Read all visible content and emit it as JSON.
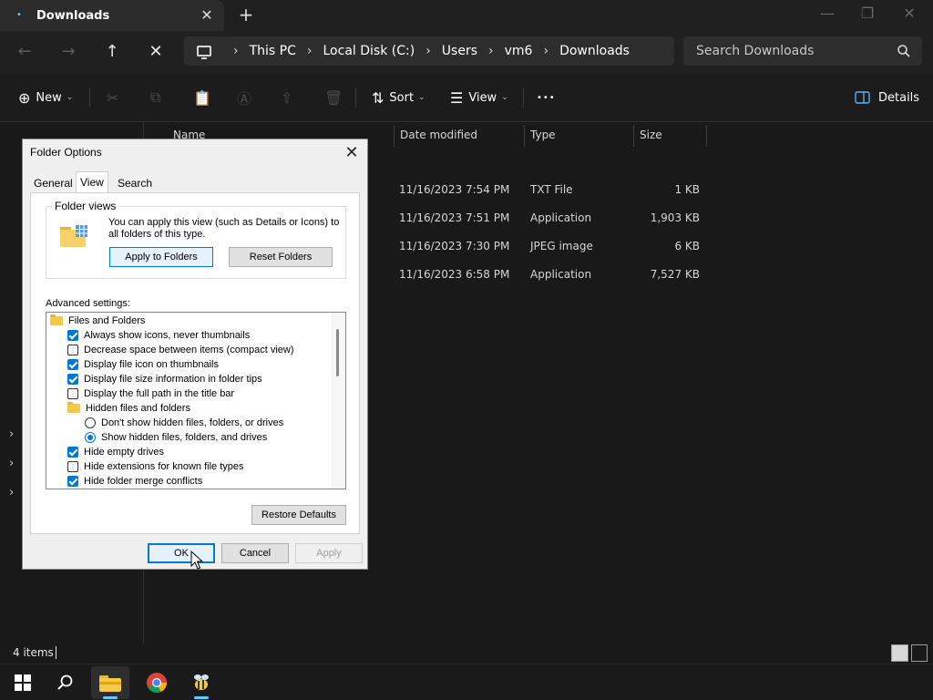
{
  "window": {
    "tab_title": "Downloads",
    "tab_close_glyph": "✕",
    "new_tab_glyph": "+",
    "minimize_glyph": "—",
    "restore_glyph": "❐",
    "close_glyph": "✕"
  },
  "nav": {
    "back_glyph": "←",
    "forward_glyph": "→",
    "up_glyph": "↑",
    "stop_glyph": "✕",
    "breadcrumbs": [
      "This PC",
      "Local Disk (C:)",
      "Users",
      "vm6",
      "Downloads"
    ],
    "separator_glyph": "›",
    "search_placeholder": "Search Downloads"
  },
  "commands": {
    "new_label": "New",
    "sort_label": "Sort",
    "view_label": "View",
    "more_glyph": "•••",
    "details_label": "Details",
    "cut_glyph": "✂",
    "copy_glyph": "⧉",
    "paste_glyph": "📋",
    "rename_glyph": "Ⓐ",
    "share_glyph": "⇪",
    "delete_glyph": "🗑",
    "new_glyph": "⊕",
    "sort_glyph": "⇅",
    "view_glyph": "☰",
    "caret_glyph": "⌄"
  },
  "columns": {
    "name": "Name",
    "date": "Date modified",
    "type": "Type",
    "size": "Size"
  },
  "files": [
    {
      "date": "11/16/2023 7:54 PM",
      "type": "TXT File",
      "size": "1 KB"
    },
    {
      "date": "11/16/2023 7:51 PM",
      "type": "Application",
      "size": "1,903 KB"
    },
    {
      "date": "11/16/2023 7:30 PM",
      "type": "JPEG image",
      "size": "6 KB"
    },
    {
      "date": "11/16/2023 6:58 PM",
      "type": "Application",
      "size": "7,527 KB"
    }
  ],
  "status": {
    "items_count": "4 items"
  },
  "tree": {
    "chevron_glyph": "›"
  },
  "dialog": {
    "title": "Folder Options",
    "close_glyph": "✕",
    "tabs": [
      "General",
      "View",
      "Search"
    ],
    "selected_tab": "View",
    "folder_views": {
      "label": "Folder views",
      "description": "You can apply this view (such as Details or Icons) to all folders of this type.",
      "apply_button": "Apply to Folders",
      "reset_button": "Reset Folders"
    },
    "advanced_label": "Advanced settings:",
    "advanced_items": [
      {
        "kind": "folder",
        "label": "Files and Folders",
        "checked": null
      },
      {
        "kind": "checkbox",
        "label": "Always show icons, never thumbnails",
        "checked": true
      },
      {
        "kind": "checkbox",
        "label": "Decrease space between items (compact view)",
        "checked": false
      },
      {
        "kind": "checkbox",
        "label": "Display file icon on thumbnails",
        "checked": true
      },
      {
        "kind": "checkbox",
        "label": "Display file size information in folder tips",
        "checked": true
      },
      {
        "kind": "checkbox",
        "label": "Display the full path in the title bar",
        "checked": false
      },
      {
        "kind": "folder",
        "label": "Hidden files and folders",
        "checked": null
      },
      {
        "kind": "radio",
        "label": "Don't show hidden files, folders, or drives",
        "checked": false
      },
      {
        "kind": "radio",
        "label": "Show hidden files, folders, and drives",
        "checked": true
      },
      {
        "kind": "checkbox",
        "label": "Hide empty drives",
        "checked": true
      },
      {
        "kind": "checkbox",
        "label": "Hide extensions for known file types",
        "checked": false
      },
      {
        "kind": "checkbox",
        "label": "Hide folder merge conflicts",
        "checked": true
      }
    ],
    "restore_defaults": "Restore Defaults",
    "ok": "OK",
    "cancel": "Cancel",
    "apply": "Apply"
  },
  "colors": {
    "accent": "#0078d7",
    "dark_bg": "#191919",
    "taskbar_indicator": "#60cdff"
  }
}
